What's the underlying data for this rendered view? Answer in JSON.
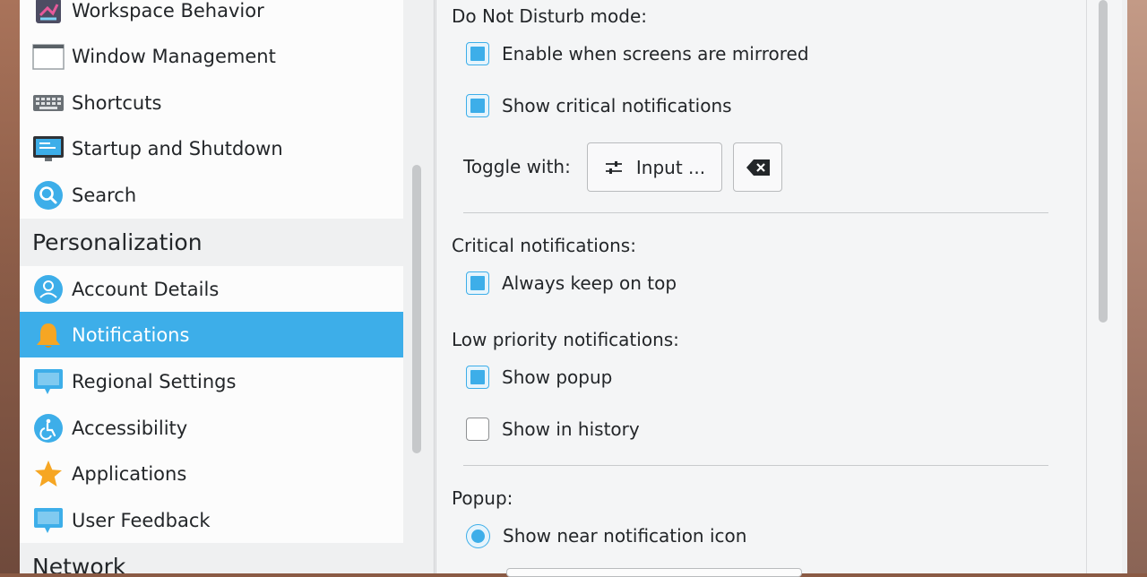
{
  "sidebar": {
    "items": [
      {
        "label": "Workspace Behavior",
        "icon": "workspace-behavior-icon"
      },
      {
        "label": "Window Management",
        "icon": "window-management-icon"
      },
      {
        "label": "Shortcuts",
        "icon": "keyboard-icon"
      },
      {
        "label": "Startup and Shutdown",
        "icon": "monitor-icon"
      },
      {
        "label": "Search",
        "icon": "search-icon"
      }
    ],
    "personalization": {
      "title": "Personalization",
      "items": [
        {
          "label": "Account Details",
          "icon": "user-icon"
        },
        {
          "label": "Notifications",
          "icon": "bell-icon",
          "selected": true
        },
        {
          "label": "Regional Settings",
          "icon": "speech-bubble-icon"
        },
        {
          "label": "Accessibility",
          "icon": "accessibility-icon"
        },
        {
          "label": "Applications",
          "icon": "star-icon"
        },
        {
          "label": "User Feedback",
          "icon": "feedback-icon"
        }
      ]
    },
    "network_title": "Network"
  },
  "content": {
    "dnd": {
      "title": "Do Not Disturb mode:",
      "mirrored_label": "Enable when screens are mirrored",
      "mirrored_checked": true,
      "critical_label": "Show critical notifications",
      "critical_checked": true,
      "toggle_label": "Toggle with:",
      "input_button_label": "Input ...",
      "input_button_icon": "sliders-icon",
      "clear_button_icon": "backspace-icon"
    },
    "critical": {
      "title": "Critical notifications:",
      "on_top_label": "Always keep on top",
      "on_top_checked": true
    },
    "low_priority": {
      "title": "Low priority notifications:",
      "popup_label": "Show popup",
      "popup_checked": true,
      "history_label": "Show in history",
      "history_checked": false
    },
    "popup": {
      "title": "Popup:",
      "near_icon_label": "Show near notification icon",
      "near_icon_selected": true
    }
  },
  "colors": {
    "accent": "#3daee9",
    "selected_text": "#ffffff",
    "text": "#232629",
    "sidebar_bg": "#fcfcfc",
    "panel_bg": "#f4f5f6"
  }
}
